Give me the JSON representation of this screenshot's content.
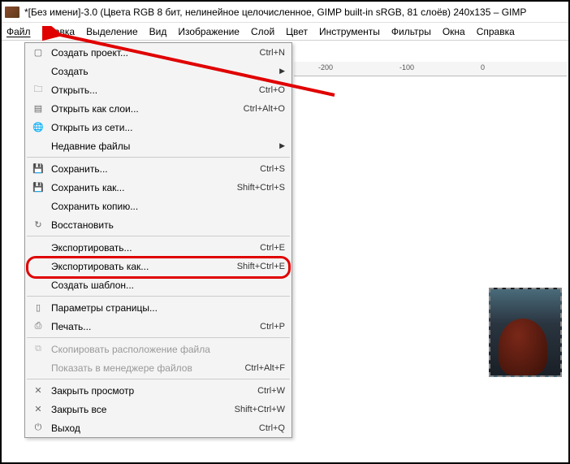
{
  "titlebar": {
    "text": "*[Без имени]-3.0 (Цвета RGB 8 бит, нелинейное целочисленное, GIMP built-in sRGB, 81 слоёв) 240x135 – GIMP"
  },
  "menubar": {
    "items": [
      "Файл",
      "Правка",
      "Выделение",
      "Вид",
      "Изображение",
      "Слой",
      "Цвет",
      "Инструменты",
      "Фильтры",
      "Окна",
      "Справка"
    ]
  },
  "ruler": {
    "t1": "-200",
    "t2": "-100",
    "t3": "0"
  },
  "menu": {
    "create_project": {
      "label": "Создать проект...",
      "shortcut": "Ctrl+N"
    },
    "create": {
      "label": "Создать"
    },
    "open": {
      "label": "Открыть...",
      "shortcut": "Ctrl+O"
    },
    "open_layers": {
      "label": "Открыть как слои...",
      "shortcut": "Ctrl+Alt+O"
    },
    "open_net": {
      "label": "Открыть из сети..."
    },
    "recent": {
      "label": "Недавние файлы"
    },
    "save": {
      "label": "Сохранить...",
      "shortcut": "Ctrl+S"
    },
    "save_as": {
      "label": "Сохранить как...",
      "shortcut": "Shift+Ctrl+S"
    },
    "save_copy": {
      "label": "Сохранить копию..."
    },
    "revert": {
      "label": "Восстановить"
    },
    "export": {
      "label": "Экспортировать...",
      "shortcut": "Ctrl+E"
    },
    "export_as": {
      "label": "Экспортировать как...",
      "shortcut": "Shift+Ctrl+E"
    },
    "create_template": {
      "label": "Создать шаблон..."
    },
    "page_setup": {
      "label": "Параметры страницы..."
    },
    "print": {
      "label": "Печать...",
      "shortcut": "Ctrl+P"
    },
    "copy_location": {
      "label": "Скопировать расположение файла"
    },
    "show_fm": {
      "label": "Показать в менеджере файлов",
      "shortcut": "Ctrl+Alt+F"
    },
    "close_view": {
      "label": "Закрыть просмотр",
      "shortcut": "Ctrl+W"
    },
    "close_all": {
      "label": "Закрыть все",
      "shortcut": "Shift+Ctrl+W"
    },
    "quit": {
      "label": "Выход",
      "shortcut": "Ctrl+Q"
    }
  }
}
